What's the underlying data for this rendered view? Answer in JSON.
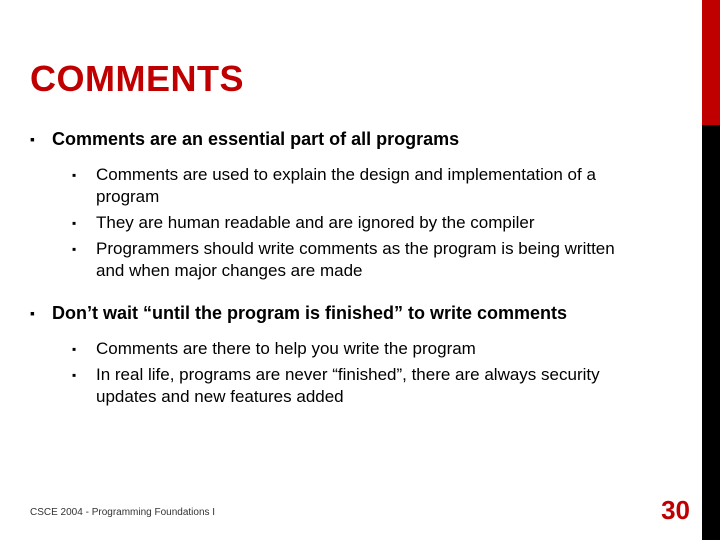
{
  "title": "COMMENTS",
  "sections": [
    {
      "heading": "Comments are an essential part of all programs",
      "items": [
        "Comments are used to explain the design and implementation of a program",
        "They are human readable and are ignored by the compiler",
        "Programmers should write comments as the program is being written and when major changes are made"
      ]
    },
    {
      "heading": "Don’t wait “until the program is finished” to write comments",
      "items": [
        "Comments are there to help you write the program",
        "In real life, programs are never “finished”, there are always security updates and new features added"
      ]
    }
  ],
  "footer": "CSCE 2004 - Programming Foundations I",
  "page_number": "30",
  "bullet_glyph": "▪"
}
